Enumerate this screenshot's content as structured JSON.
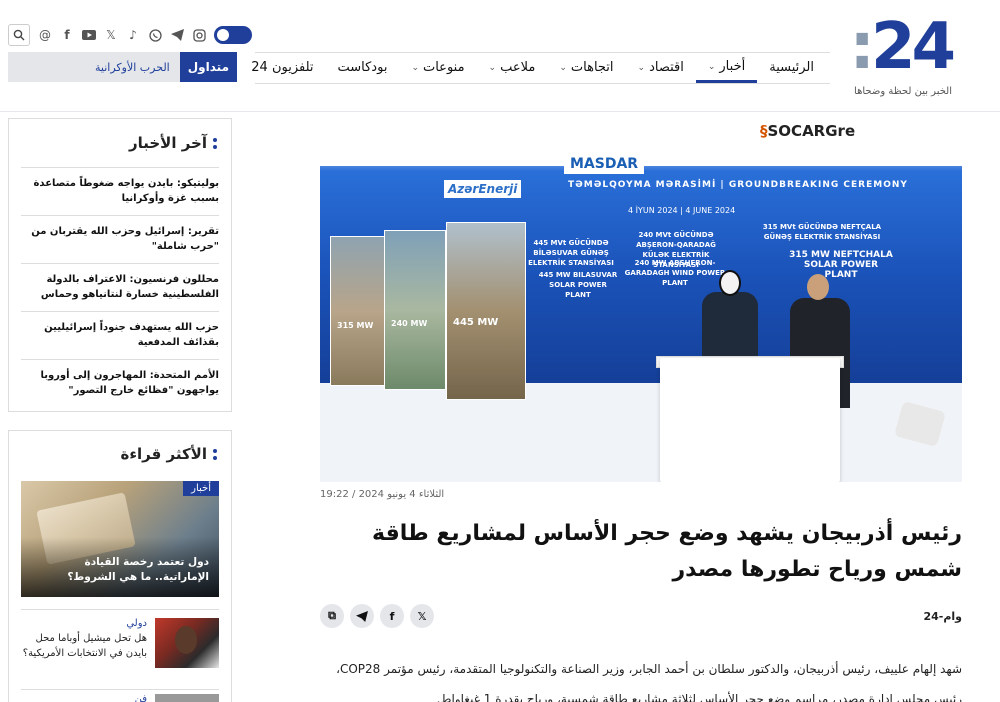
{
  "logo": {
    "text": "24",
    "tagline": "الخبر بين لحظة وضحاها"
  },
  "nav": {
    "items": [
      {
        "label": "الرئيسية",
        "has_menu": false,
        "active": false
      },
      {
        "label": "أخبار",
        "has_menu": true,
        "active": true
      },
      {
        "label": "اقتصاد",
        "has_menu": true,
        "active": false
      },
      {
        "label": "اتجاهات",
        "has_menu": true,
        "active": false
      },
      {
        "label": "ملاعب",
        "has_menu": true,
        "active": false
      },
      {
        "label": "منوعات",
        "has_menu": true,
        "active": false
      },
      {
        "label": "بودكاست",
        "has_menu": false,
        "active": false
      },
      {
        "label": "تلفزيون 24",
        "has_menu": false,
        "active": false
      }
    ]
  },
  "topbar": {
    "icons": [
      "search-icon",
      "threads-icon",
      "facebook-icon",
      "youtube-icon",
      "x-icon",
      "tiktok-icon",
      "whatsapp-icon",
      "telegram-icon",
      "instagram-icon"
    ]
  },
  "trending": {
    "label": "متداول",
    "link": "الحرب الأوكرانية"
  },
  "latest": {
    "title": "آخر الأخبار",
    "items": [
      "بوليتيكو: بايدن يواجه ضغوطاً متصاعدة بسبب غزة وأوكرانيا",
      "تقرير: إسرائيل وحزب الله يقتربان من \"حرب شاملة\"",
      "محللون فرنسيون: الاعتراف بالدولة الفلسطينية خسارة لنتانياهو وحماس",
      "حزب الله يستهدف جنوداً إسرائيليين بقذائف المدفعية",
      "الأمم المتحدة: المهاجرون إلى أوروبا يواجهون \"فظائع خارج التصور\""
    ]
  },
  "popular": {
    "title": "الأكثر قراءة",
    "feature": {
      "tag": "أخبار",
      "title": "دول تعتمد رخصة القيادة الإماراتية.. ما هي الشروط؟"
    },
    "story": {
      "category": "دولي",
      "title": "هل تحل ميشيل أوباما محل بايدن في الانتخابات الأمريكية؟"
    },
    "next_category": "فن"
  },
  "hero": {
    "brands": {
      "azerenerji": "AzərEnerji",
      "masdar": "MASDAR",
      "socar_prefix": "SOCAR",
      "socar_suffix": "Gre"
    },
    "ceremony": "TƏMƏLQOYMA MƏRASİMİ | GROUNDBREAKING CEREMONY",
    "ceremony_date": "4 İYUN 2024 | 4 JUNE 2024",
    "plant1": "445 MVt GÜCÜNDƏ BİLƏSUVAR GÜNƏŞ ELEKTRİK STANSİYASI",
    "plant1_en": "445 MW BILASUVAR SOLAR POWER PLANT",
    "plant2": "240 MVt GÜCÜNDƏ ABŞERON-QARADAĞ KÜLƏK ELEKTRİK STANSİYASI",
    "plant2_en": "240 MW ABSHERON-GARADAGH WIND POWER PLANT",
    "plant3": "315 MVt GÜCÜNDƏ NEFTÇALA GÜNƏŞ ELEKTRİK STANSİYASI",
    "plant3_en": "315 MW NEFTCHALA SOLAR POWER PLANT",
    "photo_labels": [
      "315 MW",
      "240 MW",
      "445 MW"
    ]
  },
  "article": {
    "date": "الثلاثاء 4 يونيو 2024 / 19:22",
    "title": "رئيس أذربيجان يشهد وضع حجر الأساس لمشاريع طاقة شمس ورياح تطورها مصدر",
    "source": "24-وام",
    "share_icons": [
      "copy-icon",
      "telegram-icon",
      "facebook-icon",
      "x-icon"
    ],
    "body": "شهد إلهام علييف، رئيس أذربيجان، والدكتور سلطان بن أحمد الجابر، وزير الصناعة والتكنولوجيا المتقدمة، رئيس مؤتمر COP28، رئيس مجلس إدارة مصدر، مراسم وضع حجر الأساس لثلاثة مشاريع طاقة شمسية، ورياح بقدرة 1 غيغاواط."
  },
  "colors": {
    "brand": "#1f3f9a",
    "trend_bg": "#e4e6ea"
  }
}
